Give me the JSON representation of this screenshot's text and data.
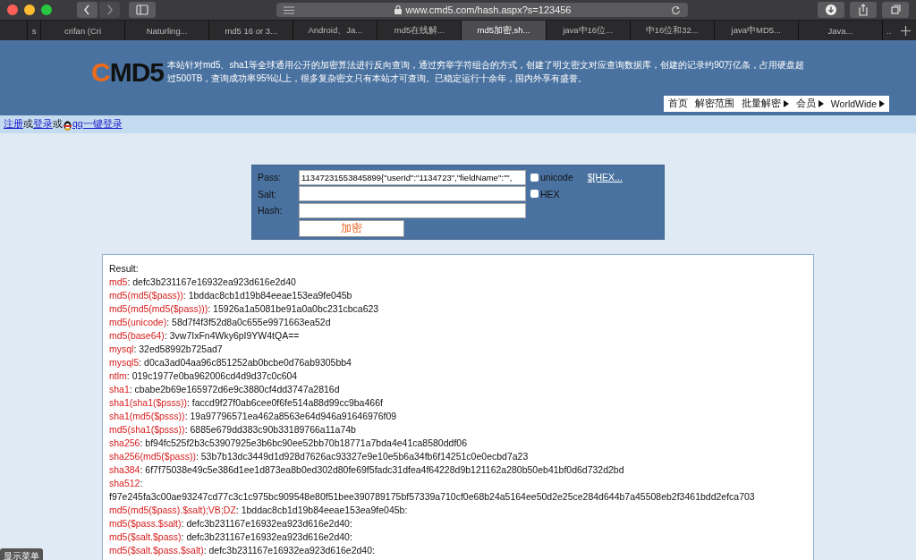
{
  "browser": {
    "url": "www.cmd5.com/hash.aspx?s=123456",
    "tabs": [
      {
        "label": "s",
        "selected": false
      },
      {
        "label": "crifan (Cri",
        "selected": false
      },
      {
        "label": "Naturling...",
        "selected": false
      },
      {
        "label": "md5 16 or 3...",
        "selected": false
      },
      {
        "label": "Android、Ja...",
        "selected": false
      },
      {
        "label": "md5在线解...",
        "selected": false
      },
      {
        "label": "md5加密,sh...",
        "selected": true
      },
      {
        "label": "java中16位...",
        "selected": false
      },
      {
        "label": "中16位和32...",
        "selected": false
      },
      {
        "label": "java中MD5...",
        "selected": false
      },
      {
        "label": "Java...",
        "selected": false
      },
      {
        "label": "..",
        "selected": false
      }
    ]
  },
  "header": {
    "logo": {
      "accent": "C",
      "rest": "MD5"
    },
    "description": "本站针对md5、sha1等全球通用公开的加密算法进行反向查询，通过穷举字符组合的方式，创建了明文密文对应查询数据库，创建的记录约90万亿条，占用硬盘超过500TB，查询成功率95%以上，很多复杂密文只有本站才可查询。已稳定运行十余年，国内外享有盛誉。",
    "nav": [
      {
        "label": "首页",
        "has_arrow": false
      },
      {
        "label": "解密范围",
        "has_arrow": false
      },
      {
        "label": "批量解密",
        "has_arrow": true
      },
      {
        "label": "会员",
        "has_arrow": true
      },
      {
        "label": "WorldWide",
        "has_arrow": true
      }
    ]
  },
  "login": [
    {
      "kind": "link",
      "text": "注册"
    },
    {
      "kind": "text",
      "text": "或"
    },
    {
      "kind": "link",
      "text": "登录"
    },
    {
      "kind": "text",
      "text": "或"
    },
    {
      "kind": "qq",
      "text": "qq一键登录"
    }
  ],
  "form": {
    "pass": {
      "label": "Pass:",
      "value": "11347231553845899{\"userId\":\"1134723\",\"fieldName\":\"\","
    },
    "unicode": {
      "label": "unicode",
      "checked": false
    },
    "hex_link": "$[HEX...",
    "salt": {
      "label": "Salt:"
    },
    "hex": {
      "label": "HEX",
      "checked": false
    },
    "hash": {
      "label": "Hash:"
    },
    "submit": "加密"
  },
  "result": {
    "title": "Result:",
    "lines": [
      {
        "label": "md5",
        "value": ": defc3b231167e16932ea923d616e2d40"
      },
      {
        "label": "md5(md5($pass))",
        "value": ": 1bddac8cb1d19b84eeae153ea9fe045b"
      },
      {
        "label": "md5(md5(md5($pass)))",
        "value": ": 15926a1a5081be91a0a0bc231cbca623"
      },
      {
        "label": "md5(unicode)",
        "value": ": 58d7f4f3f52d8a0c655e9971663ea52d"
      },
      {
        "label": "md5(base64)",
        "value": ": 3vw7IxFn4Wky6pI9YW4tQA=="
      },
      {
        "label": "mysql",
        "value": ": 32ed58992b725ad7"
      },
      {
        "label": "mysql5",
        "value": ": d0ca3ad04aa96c851252ab0bcbe0d76ab9305bb4"
      },
      {
        "label": "ntlm",
        "value": ": 019c1977e0ba962006cd4d9d37c0c604"
      },
      {
        "label": "sha1",
        "value": ": cbabe2b69e165972d6e9c3880cf4dd3747a2816d"
      },
      {
        "label": "sha1(sha1($psss))",
        "value": ": faccd9f27f0ab6cee0f6fe514a88d99cc9ba466f"
      },
      {
        "label": "sha1(md5($psss))",
        "value": ": 19a97796571ea462a8563e64d946a91646976f09"
      },
      {
        "label": "md5(sha1($psss))",
        "value": ": 6885e679dd383c90b33189766a11a74b"
      },
      {
        "label": "sha256",
        "value": ": bf94fc525f2b3c53907925e3b6bc90ee52bb70b18771a7bda4e41ca8580ddf06"
      },
      {
        "label": "sha256(md5($pass))",
        "value": ": 53b7b13dc3449d1d928d7626ac93327e9e10e5b6a34fb6f14251c0e0ecbd7a23"
      },
      {
        "label": "sha384",
        "value": ": 6f7f75038e49c5e386d1ee1d873ea8b0ed302d80fe69f5fadc31dfea4f64228d9b121162a280b50eb41bf0d6d732d2bd"
      },
      {
        "label": "sha512",
        "value": ":"
      },
      {
        "value": "f97e245fa3c00ae93247cd77c3c1c975bc909548e80f51bee390789175bf57339a710cf0e68b24a5164ee50d2e25ce284d644b7a45508eb2f3461bdd2efca703"
      },
      {
        "label": "md5(md5($pass).$salt);VB;DZ",
        "value": ": 1bddac8cb1d19b84eeae153ea9fe045b:"
      },
      {
        "label": "md5($pass.$salt)",
        "value": ": defc3b231167e16932ea923d616e2d40:"
      },
      {
        "label": "md5($salt.$pass)",
        "value": ": defc3b231167e16932ea923d616e2d40:"
      },
      {
        "label": "md5($salt.$pass.$salt)",
        "value": ": defc3b231167e16932ea923d616e2d40:"
      }
    ]
  },
  "menu_badge": "显示菜单"
}
